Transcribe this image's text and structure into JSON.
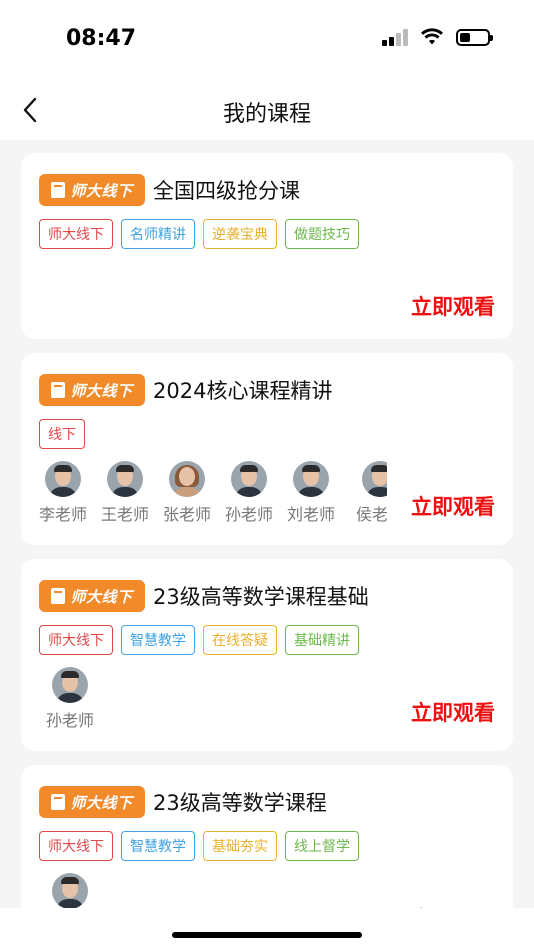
{
  "status_bar": {
    "time": "08:47"
  },
  "nav": {
    "title": "我的课程"
  },
  "brand_label": "师大线下",
  "watch_label": "立即观看",
  "courses": [
    {
      "title": "全国四级抢分课",
      "tags": [
        "师大线下",
        "名师精讲",
        "逆袭宝典",
        "做题技巧"
      ],
      "teachers": []
    },
    {
      "title": "2024核心课程精讲",
      "tags": [
        "线下"
      ],
      "teachers": [
        "李老师",
        "王老师",
        "张老师",
        "孙老师",
        "刘老师",
        "侯老师"
      ]
    },
    {
      "title": "23级高等数学课程基础",
      "tags": [
        "师大线下",
        "智慧教学",
        "在线答疑",
        "基础精讲"
      ],
      "teachers": [
        "孙老师"
      ]
    },
    {
      "title": "23级高等数学课程",
      "tags": [
        "师大线下",
        "智慧教学",
        "基础夯实",
        "线上督学"
      ],
      "teachers": [
        ""
      ]
    }
  ],
  "colors": {
    "brand_orange": "#f28a2a",
    "watch_red": "#ee1010",
    "tag_red": "#e34848",
    "tag_blue": "#3fa2e3",
    "tag_yellow": "#e9b02c",
    "tag_green": "#6cb84a"
  },
  "icons": {
    "back": "chevron-left-icon",
    "book": "book-icon",
    "signal": "cellular-signal-icon",
    "wifi": "wifi-icon",
    "battery": "battery-icon"
  }
}
